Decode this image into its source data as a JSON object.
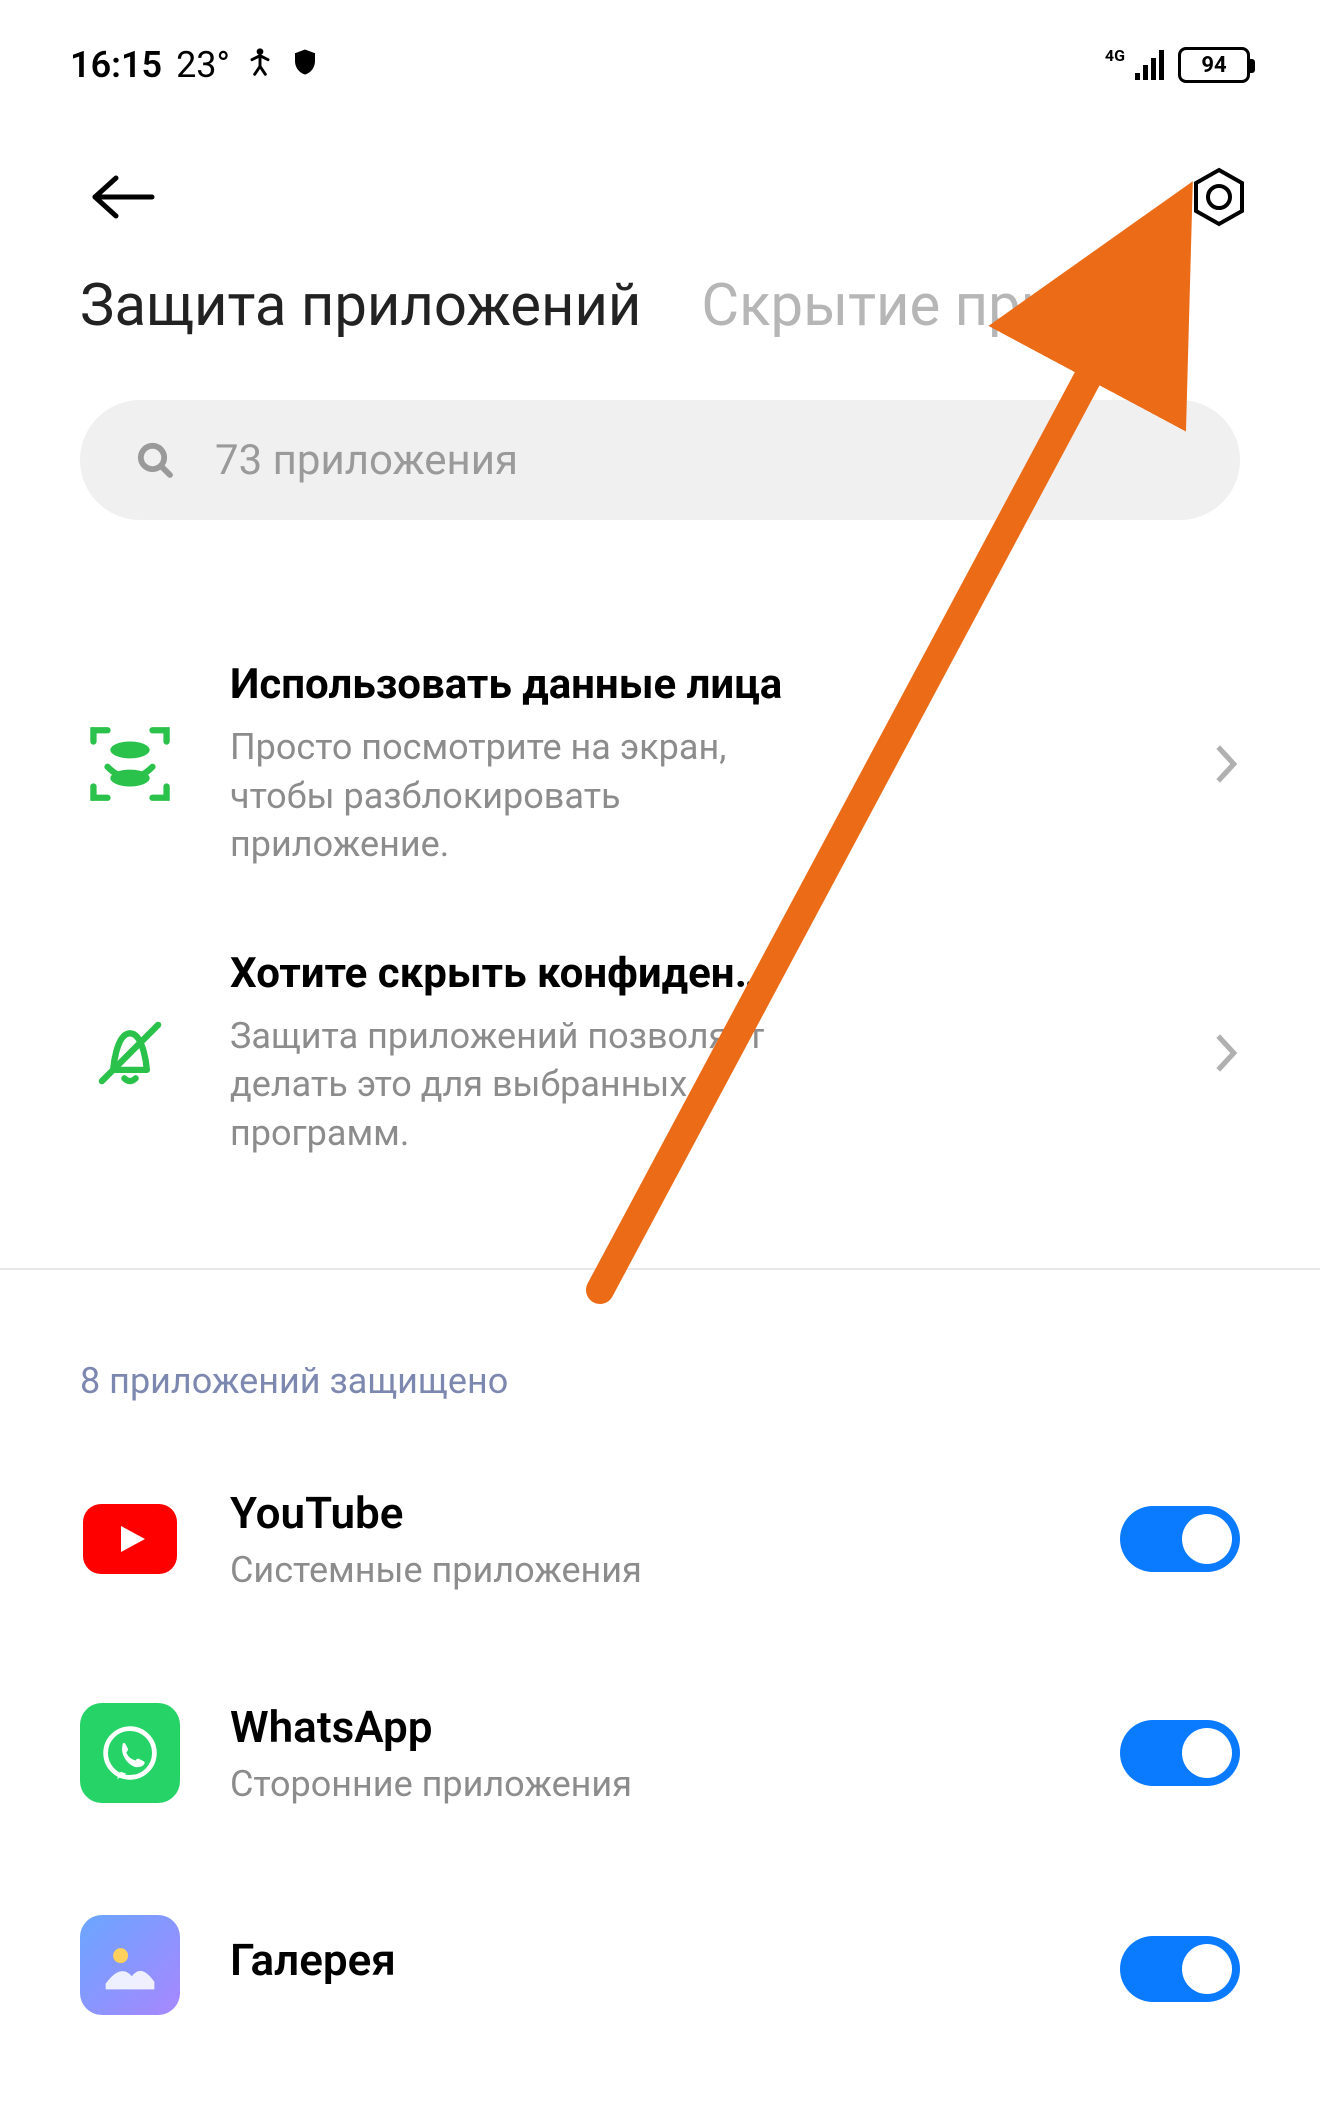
{
  "status": {
    "time": "16:15",
    "temp": "23°",
    "net_label": "4G",
    "battery": "94"
  },
  "tabs": {
    "active": "Защита приложений",
    "inactive": "Скрытие прил"
  },
  "search": {
    "placeholder": "73 приложения"
  },
  "options": {
    "face": {
      "title": "Использовать данные лица",
      "sub": "Просто посмотрите на экран, чтобы разблокировать приложение."
    },
    "hide": {
      "title": "Хотите скрыть конфиденциальны…",
      "sub": "Защита приложений позволяет делать это для выбранных программ."
    }
  },
  "section": {
    "protected_header": "8 приложений защищено"
  },
  "apps": [
    {
      "name": "YouTube",
      "sub": "Системные приложения"
    },
    {
      "name": "WhatsApp",
      "sub": "Сторонние приложения"
    },
    {
      "name": "Галерея",
      "sub": ""
    }
  ],
  "colors": {
    "accent": "#0a7aff",
    "arrow": "#ec6b17",
    "green": "#2bc24b"
  }
}
